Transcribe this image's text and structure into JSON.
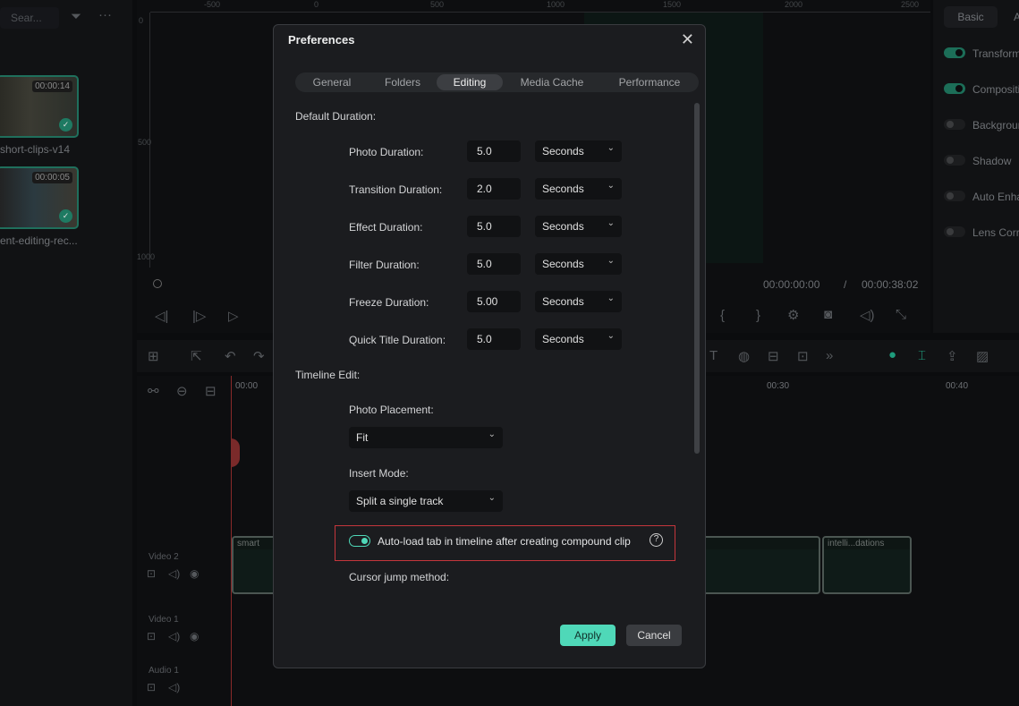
{
  "media": {
    "search_placeholder": "Sear...",
    "items": [
      {
        "name": "short-clips-v14",
        "duration": "00:00:14"
      },
      {
        "name": "ent-editing-rec...",
        "duration": "00:00:05"
      }
    ]
  },
  "ruler": {
    "top": [
      "-500",
      "0",
      "500",
      "1000",
      "1500",
      "2000",
      "2500"
    ],
    "left": [
      "0",
      "500",
      "1000"
    ]
  },
  "player": {
    "current_time": "00:00:00:00",
    "separator": "/",
    "total_time": "00:00:38:02"
  },
  "properties": {
    "tabs": [
      "Basic",
      "A"
    ],
    "items": [
      {
        "label": "Transform",
        "on": true
      },
      {
        "label": "Compositing",
        "on": true
      },
      {
        "label": "Background",
        "on": false
      },
      {
        "label": "Shadow",
        "on": false
      },
      {
        "label": "Auto Enhance",
        "on": false
      },
      {
        "label": "Lens Correction",
        "on": false
      }
    ]
  },
  "timeline": {
    "ticks": [
      "00:00",
      "00:30",
      "00:40"
    ],
    "tracks": [
      "Video 2",
      "Video 1",
      "Audio 1"
    ],
    "clips": [
      "smart",
      "intelli...dations"
    ]
  },
  "dialog": {
    "title": "Preferences",
    "tabs": [
      "General",
      "Folders",
      "Editing",
      "Media Cache",
      "Performance"
    ],
    "active_tab": "Editing",
    "default_duration": {
      "heading": "Default Duration:",
      "rows": [
        {
          "label": "Photo Duration:",
          "value": "5.0",
          "unit": "Seconds"
        },
        {
          "label": "Transition Duration:",
          "value": "2.0",
          "unit": "Seconds"
        },
        {
          "label": "Effect Duration:",
          "value": "5.0",
          "unit": "Seconds"
        },
        {
          "label": "Filter Duration:",
          "value": "5.0",
          "unit": "Seconds"
        },
        {
          "label": "Freeze Duration:",
          "value": "5.00",
          "unit": "Seconds"
        },
        {
          "label": "Quick Title Duration:",
          "value": "5.0",
          "unit": "Seconds"
        }
      ]
    },
    "timeline_edit": {
      "heading": "Timeline Edit:",
      "photo_placement_label": "Photo Placement:",
      "photo_placement_value": "Fit",
      "insert_mode_label": "Insert Mode:",
      "insert_mode_value": "Split a single track",
      "autoload_label": "Auto-load tab in timeline after creating compound clip",
      "autoload_on": true,
      "cursor_jump_label": "Cursor jump method:"
    },
    "apply_label": "Apply",
    "cancel_label": "Cancel",
    "accent": "#4fd8b8"
  }
}
